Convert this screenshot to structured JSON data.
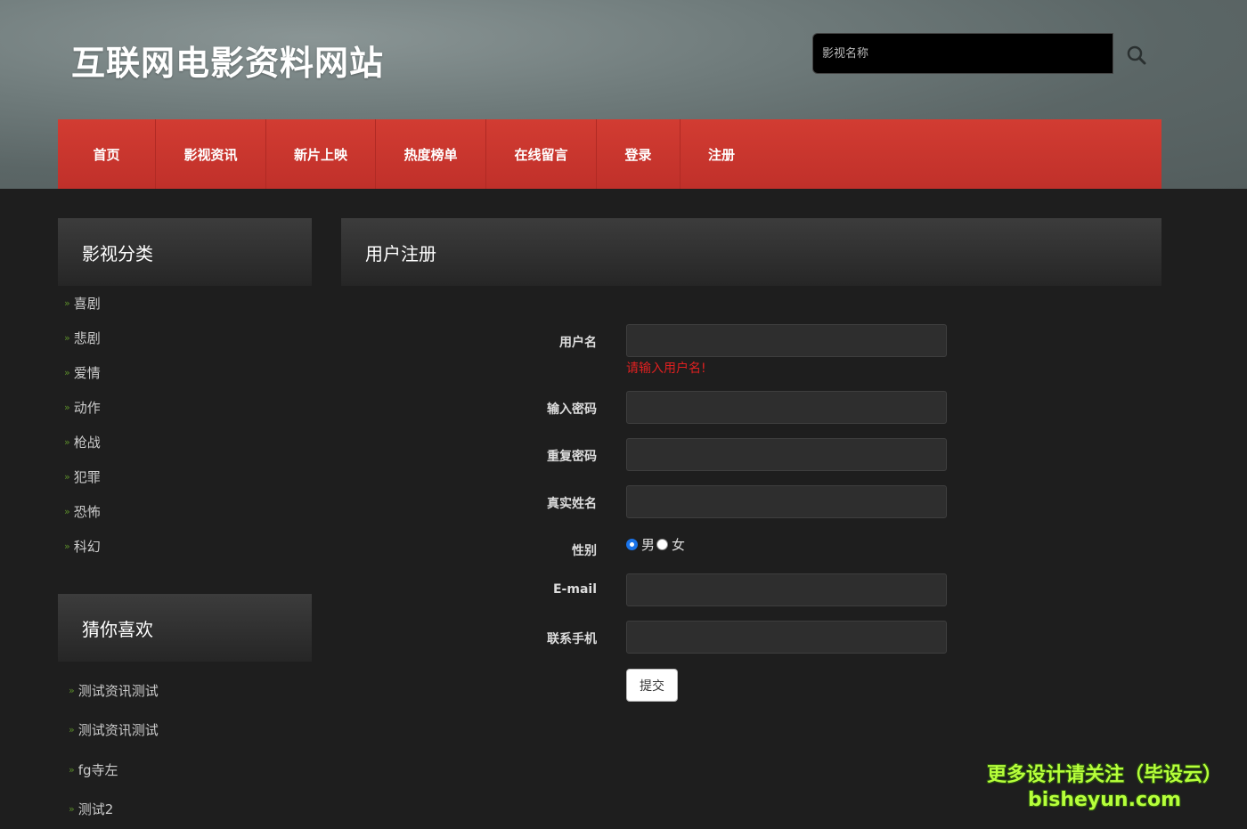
{
  "header": {
    "site_title": "互联网电影资料网站",
    "search_placeholder": "影视名称"
  },
  "nav": {
    "items": [
      "首页",
      "影视资讯",
      "新片上映",
      "热度榜单",
      "在线留言",
      "登录",
      "注册"
    ]
  },
  "sidebar": {
    "category_title": "影视分类",
    "categories": [
      "喜剧",
      "悲剧",
      "爱情",
      "动作",
      "枪战",
      "犯罪",
      "恐怖",
      "科幻"
    ],
    "recommend_title": "猜你喜欢",
    "recommends": [
      "测试资讯测试",
      "测试资讯测试",
      "fg寺左",
      "测试2"
    ]
  },
  "main": {
    "title": "用户注册",
    "form": {
      "username_label": "用户名",
      "username_error": "请输入用户名!",
      "password_label": "输入密码",
      "repeat_password_label": "重复密码",
      "real_name_label": "真实姓名",
      "gender_label": "性别",
      "gender_male": "男",
      "gender_female": "女",
      "gender_selected": "男",
      "email_label": "E-mail",
      "phone_label": "联系手机",
      "submit_label": "提交"
    }
  },
  "watermark": {
    "line1": "更多设计请关注（毕设云）",
    "line2": "bisheyun.com"
  },
  "colors": {
    "nav_red": "#c9362d",
    "background": "#1e1e1e",
    "error_red": "#e02020",
    "bullet_green": "#5a8a2a"
  }
}
